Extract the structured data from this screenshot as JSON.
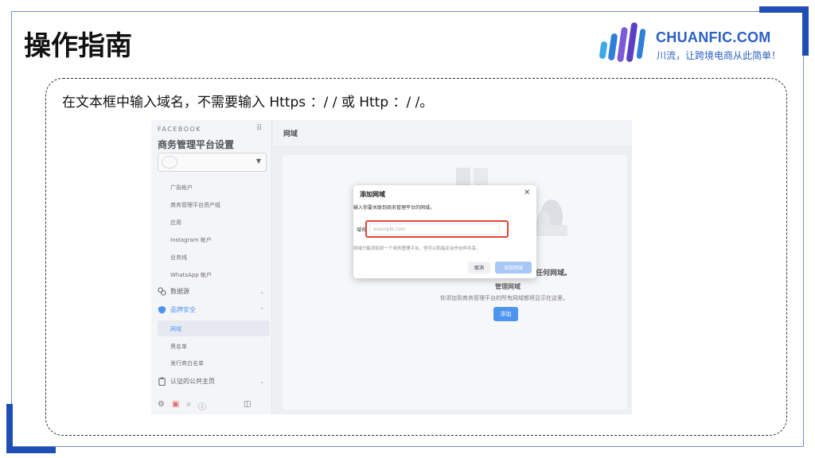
{
  "slide": {
    "title": "操作指南",
    "instruction": "在文本框中输入域名，不需要输入 Https ：/ / 或 Http ：/ /。",
    "colors": {
      "accent": "#1f4fb5",
      "logo_blue": "#2a5fc4",
      "highlight_red": "#e0453a"
    }
  },
  "logo": {
    "brand": "CHUANFIC.COM",
    "slogan": "川流，让跨境电商从此简单！"
  },
  "screenshot": {
    "sidebar": {
      "brand": "FACEBOOK",
      "title": "商务管理平台设置",
      "items": [
        "广告帐户",
        "商务管理平台资产组",
        "应用",
        "Instagram 帐户",
        "业务线",
        "WhatsApp 帐户"
      ],
      "sections": {
        "data_sources": "数据源",
        "brand_safety": "品牌安全",
        "verified_pages": "认证的公共主页"
      },
      "brand_safety_items": [
        "网域",
        "黑名单",
        "发行商白名单"
      ]
    },
    "header": {
      "title": "网域"
    },
    "panel": {
      "empty_title": "任何网域。",
      "manage_title": "管理网域",
      "description": "你添加到商务管理平台的所有网域都将显示在这里。",
      "add_button": "添加"
    },
    "modal": {
      "title": "添加网域",
      "subtitle": "输入你要关联到商务管理平台的网域。",
      "field_label": "域名",
      "placeholder": "example.com",
      "note": "网域只能添加到一个商务管理平台，但可以和指定合作伙伴共享。",
      "cancel": "取消",
      "confirm": "添加网域"
    }
  }
}
